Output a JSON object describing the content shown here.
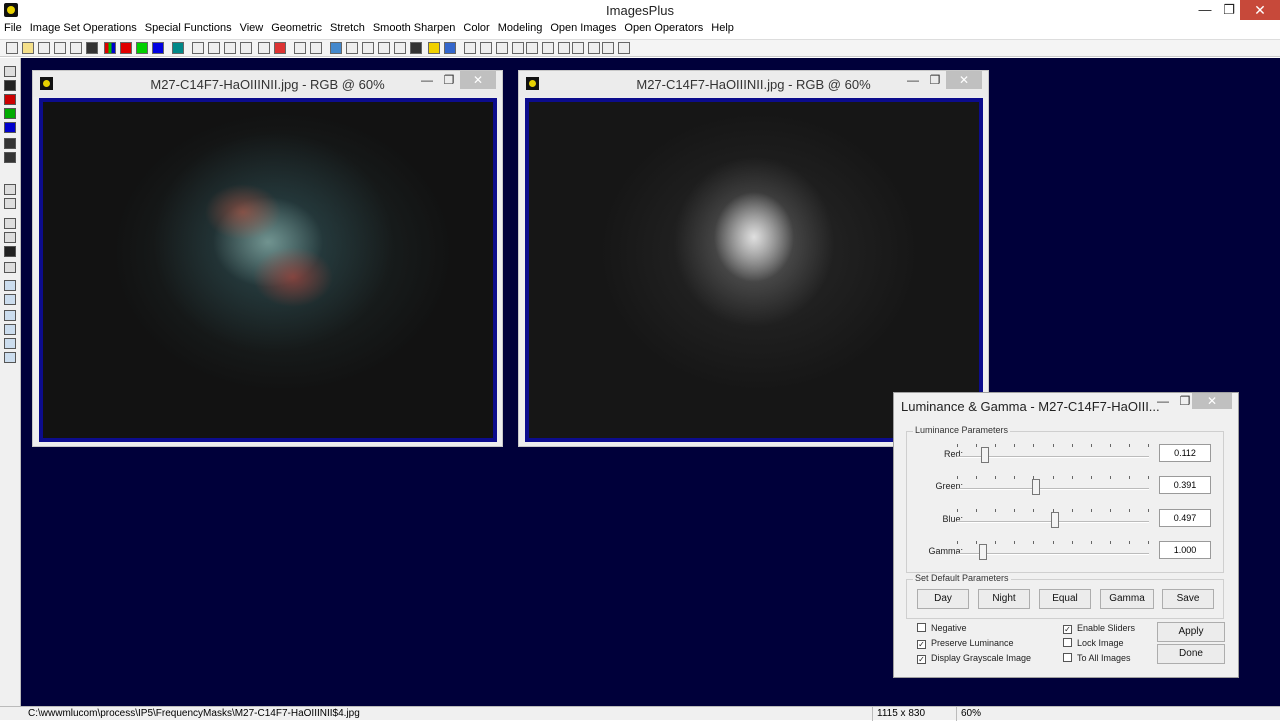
{
  "app": {
    "title": "ImagesPlus",
    "icon": "images-plus-logo-icon",
    "window_buttons": [
      "—",
      "❐",
      "✕"
    ]
  },
  "menu": [
    "File",
    "Image Set Operations",
    "Special Functions",
    "View",
    "Geometric",
    "Stretch",
    "Smooth Sharpen",
    "Color",
    "Modeling",
    "Open Images",
    "Open Operators",
    "Help"
  ],
  "windows": [
    {
      "title": "M27-C14F7-HaOIIINII.jpg - RGB @ 60%",
      "kind": "color-image"
    },
    {
      "title": "M27-C14F7-HaOIIINII.jpg - RGB @ 60%",
      "kind": "grayscale-image"
    }
  ],
  "dialog": {
    "title": "Luminance & Gamma - M27-C14F7-HaOIII...",
    "lum_group": "Luminance Parameters",
    "sliders": [
      {
        "label": "Red:",
        "value": "0.112",
        "pos": 0.13
      },
      {
        "label": "Green:",
        "value": "0.391",
        "pos": 0.41
      },
      {
        "label": "Blue:",
        "value": "0.497",
        "pos": 0.51
      },
      {
        "label": "Gamma:",
        "value": "1.000",
        "pos": 0.12
      }
    ],
    "default_group": "Set Default Parameters",
    "default_buttons": [
      "Day",
      "Night",
      "Equal",
      "Gamma",
      "Save"
    ],
    "checks_left": [
      {
        "label": "Negative",
        "checked": false
      },
      {
        "label": "Preserve Luminance",
        "checked": true
      },
      {
        "label": "Display Grayscale Image",
        "checked": true
      }
    ],
    "checks_right": [
      {
        "label": "Enable Sliders",
        "checked": true
      },
      {
        "label": "Lock Image",
        "checked": false
      },
      {
        "label": "To All Images",
        "checked": false
      }
    ],
    "apply_label": "Apply",
    "done_label": "Done"
  },
  "status": {
    "path": "C:\\wwwmlucom\\process\\IP5\\FrequencyMasks\\M27-C14F7-HaOIIINII$4.jpg",
    "dimensions": "1115 x 830",
    "zoom": "60%"
  }
}
